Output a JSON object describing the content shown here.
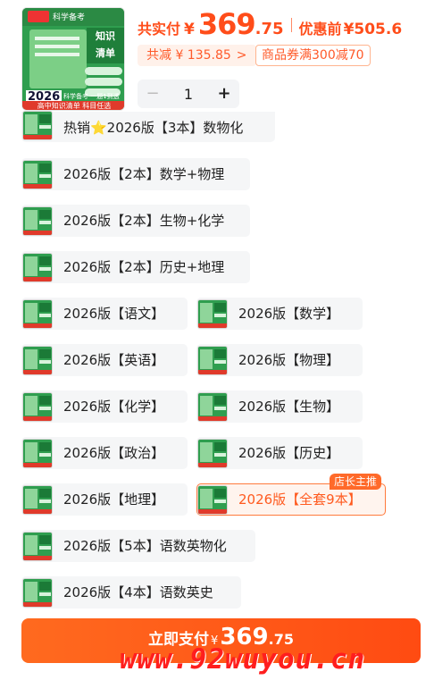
{
  "cover": {
    "brand": "科学备考",
    "title_line1": "知识",
    "title_line2": "清单",
    "year": "2026",
    "tag": "科学备考 一题1到透了",
    "bottom_text": "高中知识清单 科目任选"
  },
  "price": {
    "label": "共实付",
    "currency": "¥",
    "integer": "369",
    "decimal": ".75",
    "pre_label": "优惠前",
    "pre_value": "¥505.6",
    "discount": "共减 ¥ 135.85",
    "discount_arrow": ">",
    "coupon": "商品券满300减70"
  },
  "quantity": {
    "minus": "−",
    "value": "1",
    "plus": "+"
  },
  "options": [
    {
      "label": "热销⭐2026版【3本】数物化"
    },
    {
      "label": "2026版【2本】数学+物理"
    },
    {
      "label": "2026版【2本】生物+化学"
    },
    {
      "label": "2026版【2本】历史+地理"
    },
    {
      "label": "2026版【语文】"
    },
    {
      "label": "2026版【数学】"
    },
    {
      "label": "2026版【英语】"
    },
    {
      "label": "2026版【物理】"
    },
    {
      "label": "2026版【化学】"
    },
    {
      "label": "2026版【生物】"
    },
    {
      "label": "2026版【政治】"
    },
    {
      "label": "2026版【历史】"
    },
    {
      "label": "2026版【地理】"
    },
    {
      "label": "2026版【全套9本】",
      "selected": true,
      "badge": "店长主推"
    },
    {
      "label": "2026版【5本】语数英物化"
    },
    {
      "label": "2026版【4本】语数英史"
    }
  ],
  "pay": {
    "label": "立即支付",
    "currency": "¥",
    "integer": "369",
    "decimal": ".75"
  },
  "watermark": "www.92wuyou.cn",
  "colors": {
    "accent": "#ff5a1f",
    "selected_border": "#ff7a3d",
    "chip_bg": "#f5f6f7"
  }
}
